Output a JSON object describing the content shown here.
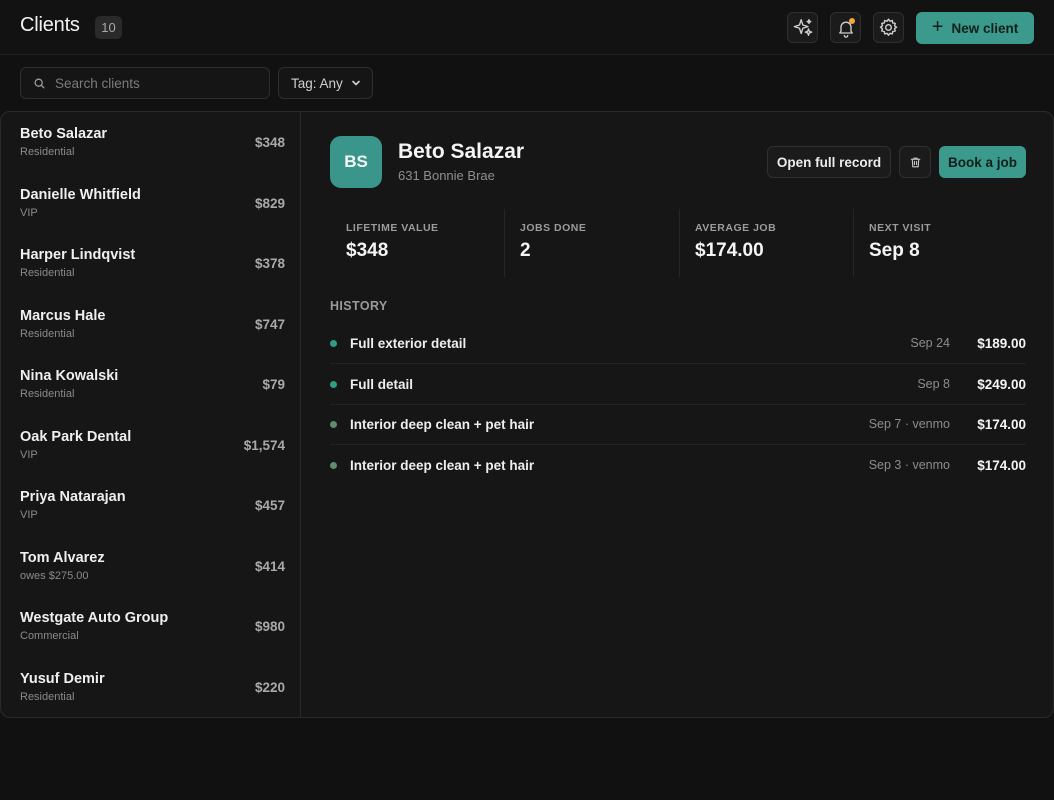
{
  "header": {
    "title": "Clients",
    "count": "10",
    "new_client_label": "New client",
    "icons": [
      "sparkle-icon",
      "bell-icon",
      "gear-icon"
    ],
    "notification_dot_color": "#f3a83c"
  },
  "filters": {
    "search_placeholder": "Search clients",
    "search_value": "",
    "tag_label": "Tag: Any"
  },
  "clients": [
    {
      "name": "Beto Salazar",
      "tag": "Residential",
      "amount": "$348"
    },
    {
      "name": "Danielle Whitfield",
      "tag": "VIP",
      "amount": "$829"
    },
    {
      "name": "Harper Lindqvist",
      "tag": "Residential",
      "amount": "$378"
    },
    {
      "name": "Marcus Hale",
      "tag": "Residential",
      "amount": "$747"
    },
    {
      "name": "Nina Kowalski",
      "tag": "Residential",
      "amount": "$79"
    },
    {
      "name": "Oak Park Dental",
      "tag": "VIP",
      "amount": "$1,574"
    },
    {
      "name": "Priya Natarajan",
      "tag": "VIP",
      "amount": "$457"
    },
    {
      "name": "Tom Alvarez",
      "tag": "owes $275.00",
      "amount": "$414"
    },
    {
      "name": "Westgate Auto Group",
      "tag": "Commercial",
      "amount": "$980"
    },
    {
      "name": "Yusuf Demir",
      "tag": "Residential",
      "amount": "$220"
    }
  ],
  "detail": {
    "initials": "BS",
    "name": "Beto Salazar",
    "address": "631 Bonnie Brae",
    "open_record_label": "Open full record",
    "book_job_label": "Book a job",
    "accent_color": "#3b9a8c",
    "stats": [
      {
        "label": "LIFETIME VALUE",
        "value": "$348"
      },
      {
        "label": "JOBS DONE",
        "value": "2"
      },
      {
        "label": "AVERAGE JOB",
        "value": "$174.00"
      },
      {
        "label": "NEXT VISIT",
        "value": "Sep 8"
      }
    ],
    "history_label": "HISTORY",
    "history": [
      {
        "title": "Full exterior detail",
        "meta": "Sep 24",
        "amount": "$189.00",
        "dot_color": "#2f9d83"
      },
      {
        "title": "Full detail",
        "meta": "Sep 8",
        "amount": "$249.00",
        "dot_color": "#2f9d83"
      },
      {
        "title": "Interior deep clean + pet hair",
        "meta": "Sep 7 · venmo",
        "amount": "$174.00",
        "dot_color": "#5d8c6f"
      },
      {
        "title": "Interior deep clean + pet hair",
        "meta": "Sep 3 · venmo",
        "amount": "$174.00",
        "dot_color": "#5d8c6f"
      }
    ]
  }
}
